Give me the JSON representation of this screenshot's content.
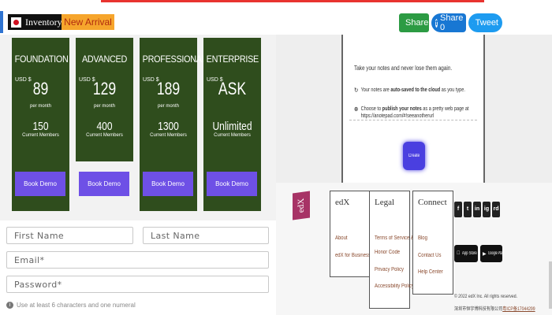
{
  "header": {
    "inventory_label": "Inventory",
    "new_arrival_label": "New Arrival",
    "share": {
      "email_label": "Share",
      "facebook_label": "Share 0",
      "twitter_label": "Tweet"
    },
    "colors": {
      "accent_red": "#e8332f",
      "inventory_bg": "#111111",
      "new_arrival_bg": "#f6a52c"
    }
  },
  "pricing": {
    "currency": "USD $",
    "per_label": "per month",
    "members_label": "Current Members",
    "plans": [
      {
        "name": "FOUNDATION",
        "price": "89",
        "members": "150",
        "cta": "Book Demo"
      },
      {
        "name": "ADVANCED",
        "price": "129",
        "members": "400",
        "cta": "Book Demo"
      },
      {
        "name": "PROFESSIONAL",
        "price": "189",
        "members": "1300",
        "cta": "Book Demo"
      },
      {
        "name": "ENTERPRISE",
        "price": "ASK",
        "members": "Unlimited",
        "cta": "Book Demo"
      }
    ],
    "colors": {
      "card": "#2f4d1d",
      "button": "#6e50e6"
    }
  },
  "form": {
    "first_name_placeholder": "First Name",
    "last_name_placeholder": "Last Name",
    "email_placeholder": "Email*",
    "password_placeholder": "Password*",
    "password_hint": "Use at least 6 characters and one numeral"
  },
  "notes": {
    "intro": "Take your notes and never lose them again.",
    "item1_pre": "Your notes are ",
    "item1_bold": "auto-saved to the cloud",
    "item1_post": " as you type.",
    "item2_pre": "Choose to ",
    "item2_bold": "publish your notes",
    "item2_post": " as a pretty web page at",
    "item2_url": "https://anotepad.com/#!seeanotherurl",
    "create_label": "Create Note"
  },
  "footer": {
    "logo_text": "edX",
    "col1": {
      "title": "edX",
      "links": [
        "About",
        "edX for Business"
      ]
    },
    "col2": {
      "title": "Legal",
      "links": [
        "Terms of Service &",
        "Honor Code",
        "Privacy Policy",
        "Accessibility Policy"
      ]
    },
    "col3": {
      "title": "Connect",
      "links": [
        "Blog",
        "Contact Us",
        "Help Center"
      ]
    },
    "social": [
      "f",
      "t",
      "in",
      "ig",
      "rd"
    ],
    "app_store_label": "App Store",
    "google_play_label": "Google Play",
    "copyright": "© 2022 edX Inc. All rights reserved.",
    "icp_prefix": "深圳市恒宇博科技有限公司",
    "icp_link": "粤ICP备17044299"
  }
}
